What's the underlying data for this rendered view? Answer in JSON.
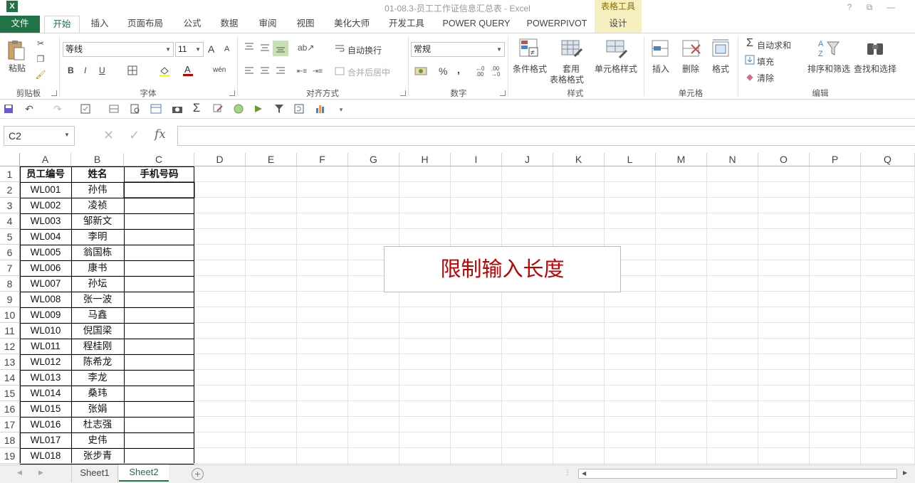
{
  "window": {
    "title": "01-08.3-员工工作证信息汇总表 - Excel",
    "context_tab_group": "表格工具",
    "buttons": [
      "?",
      "⧉",
      "—"
    ]
  },
  "tabs": {
    "file": "文件",
    "home": "开始",
    "insert": "插入",
    "page_layout": "页面布局",
    "formulas": "公式",
    "data": "数据",
    "review": "审阅",
    "view": "视图",
    "beautify": "美化大师",
    "developer": "开发工具",
    "power_query": "POWER QUERY",
    "power_pivot": "POWERPIVOT",
    "design": "设计"
  },
  "ribbon": {
    "clipboard": {
      "label": "剪贴板",
      "paste": "粘贴"
    },
    "font": {
      "label": "字体",
      "font_name": "等线",
      "font_size": "11",
      "bold": "B",
      "italic": "I",
      "underline": "U",
      "grow": "A",
      "shrink": "A",
      "pinyin": "wén"
    },
    "alignment": {
      "label": "对齐方式",
      "wrap_text": "自动换行",
      "merge_center": "合并后居中"
    },
    "number": {
      "label": "数字",
      "format": "常规",
      "percent": "%",
      "comma": ",",
      "inc_decimal": "←0 .00",
      "dec_decimal": ".00 →0"
    },
    "styles": {
      "label": "样式",
      "conditional": "条件格式",
      "table_fmt_line1": "套用",
      "table_fmt_line2": "表格格式",
      "cell_styles": "单元格样式"
    },
    "cells": {
      "label": "单元格",
      "insert": "插入",
      "delete": "删除",
      "format": "格式"
    },
    "editing": {
      "label": "编辑",
      "autosum": "自动求和",
      "fill": "填充",
      "clear": "清除",
      "sort_filter": "排序和筛选",
      "find_select": "查找和选择"
    }
  },
  "formula_bar": {
    "name_box": "C2",
    "fx": "fx",
    "value": ""
  },
  "columns": [
    "A",
    "B",
    "C",
    "D",
    "E",
    "F",
    "G",
    "H",
    "I",
    "J",
    "K",
    "L",
    "M",
    "N",
    "O",
    "P",
    "Q"
  ],
  "rows": [
    "1",
    "2",
    "3",
    "4",
    "5",
    "6",
    "7",
    "8",
    "9",
    "10",
    "11",
    "12",
    "13",
    "14",
    "15",
    "16",
    "17",
    "18",
    "19"
  ],
  "table": {
    "headers": [
      "员工编号",
      "姓名",
      "手机号码"
    ],
    "data": [
      [
        "WL001",
        "孙伟",
        ""
      ],
      [
        "WL002",
        "凌祯",
        ""
      ],
      [
        "WL003",
        "邹新文",
        ""
      ],
      [
        "WL004",
        "李明",
        ""
      ],
      [
        "WL005",
        "翁国栋",
        ""
      ],
      [
        "WL006",
        "康书",
        ""
      ],
      [
        "WL007",
        "孙坛",
        ""
      ],
      [
        "WL008",
        "张一波",
        ""
      ],
      [
        "WL009",
        "马鑫",
        ""
      ],
      [
        "WL010",
        "倪国梁",
        ""
      ],
      [
        "WL011",
        "程桂刚",
        ""
      ],
      [
        "WL012",
        "陈希龙",
        ""
      ],
      [
        "WL013",
        "李龙",
        ""
      ],
      [
        "WL014",
        "桑玮",
        ""
      ],
      [
        "WL015",
        "张娟",
        ""
      ],
      [
        "WL016",
        "杜志强",
        ""
      ],
      [
        "WL017",
        "史伟",
        ""
      ],
      [
        "WL018",
        "张步青",
        ""
      ]
    ]
  },
  "callout": {
    "text": "限制输入长度"
  },
  "sheets": {
    "tabs": [
      "Sheet1",
      "Sheet2"
    ],
    "active": "Sheet2"
  },
  "colors": {
    "excel_green": "#217346",
    "callout_red": "#c00000",
    "context_yellow": "#f6f0c0"
  }
}
